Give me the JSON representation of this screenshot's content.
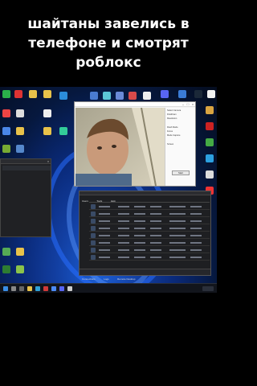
{
  "caption": {
    "line1": "шайтаны завелись в",
    "line2": "телефоне и смотрят",
    "line3": "роблокс"
  },
  "colors": {
    "wallpaper": "#0a2a7a",
    "taskbar": "#12151c",
    "dark_app": "#1e1f22"
  },
  "camera_window": {
    "side_panel": [
      "Select Camera",
      "DroidCam",
      "Resolution",
      "Flash Mode",
      "Focus",
      "Mode Capture",
      "Screen"
    ],
    "button": "Start"
  },
  "dark_app": {
    "tabs": [
      "Users",
      "Tools",
      "Help"
    ],
    "bottom_tabs": [
      "Connections",
      "Logs",
      "Remote Desktop"
    ]
  },
  "taskbar": {
    "icons": [
      "start-icon",
      "search-icon",
      "taskview-icon",
      "explorer-icon",
      "edge-icon",
      "store-icon",
      "app-icon",
      "chrome-icon",
      "app-icon"
    ]
  }
}
